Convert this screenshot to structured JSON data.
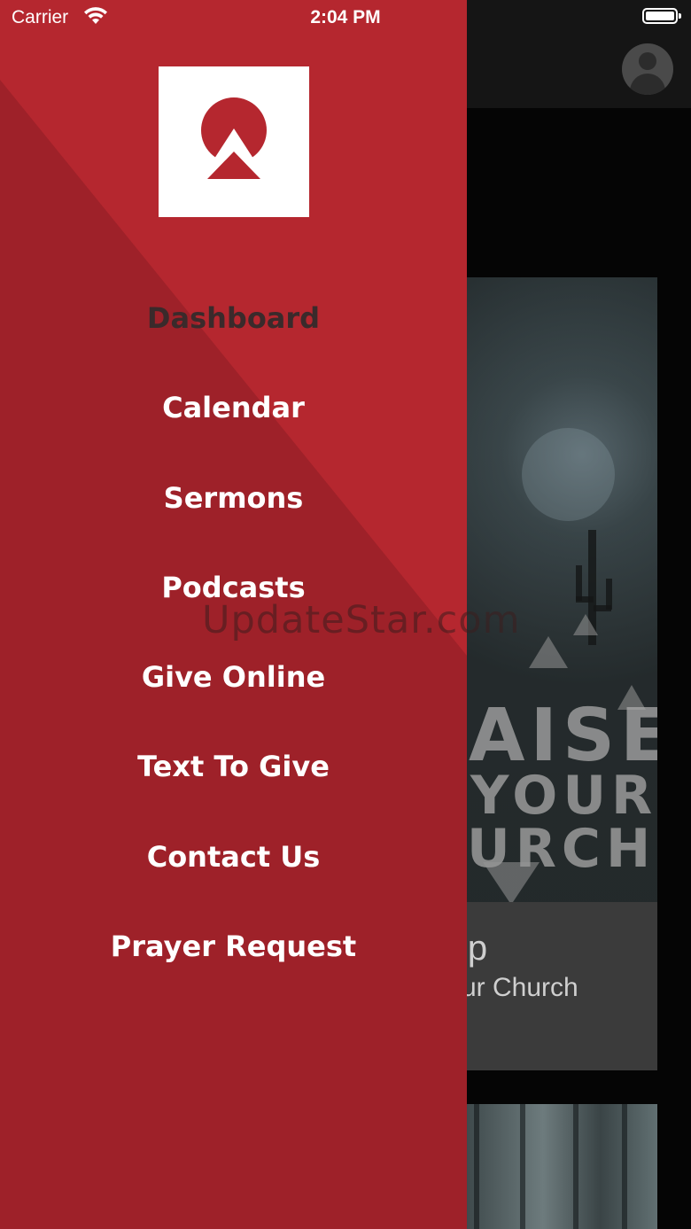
{
  "status_bar": {
    "carrier": "Carrier",
    "time": "2:04 PM",
    "wifi_icon": "wifi-icon",
    "battery_icon": "battery-full-icon"
  },
  "drawer": {
    "logo_icon": "church-logo-icon",
    "menu": [
      {
        "label": "Dashboard",
        "active": true
      },
      {
        "label": "Calendar",
        "active": false
      },
      {
        "label": "Sermons",
        "active": false
      },
      {
        "label": "Podcasts",
        "active": false
      },
      {
        "label": "Give Online",
        "active": false
      },
      {
        "label": "Text To Give",
        "active": false
      },
      {
        "label": "Contact Us",
        "active": false
      },
      {
        "label": "Prayer Request",
        "active": false
      }
    ],
    "colors": {
      "primary": "#b5272f",
      "dark": "#9e2129",
      "active_text": "#3a2a2b"
    }
  },
  "background_app": {
    "avatar_icon": "user-avatar-icon",
    "feature_card": {
      "image_text": [
        "AISE",
        "YOUR",
        "URCH"
      ],
      "title": "ip",
      "subtitle": "ur Church"
    }
  },
  "watermark": "UpdateStar.com"
}
